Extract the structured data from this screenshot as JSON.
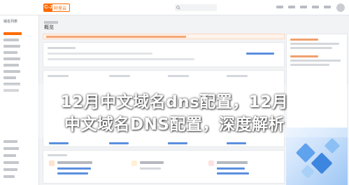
{
  "header": {
    "logo_mark": "C-J",
    "logo_text": "阿里云"
  },
  "sidebar": {
    "title": "域名列表"
  },
  "main": {
    "page_title": "概览"
  },
  "overlay": {
    "line1": "12月中文域名dns配置，12月",
    "line2": "中文域名DNS配置，深度解析"
  },
  "colors": {
    "brand": "#ff6a00",
    "link": "#5b8fe0",
    "overlay_text": "#ffffff"
  },
  "icons": [
    "search-icon",
    "user-avatar-icon",
    "notice-icon",
    "guide-icon",
    "cube-illustration"
  ]
}
